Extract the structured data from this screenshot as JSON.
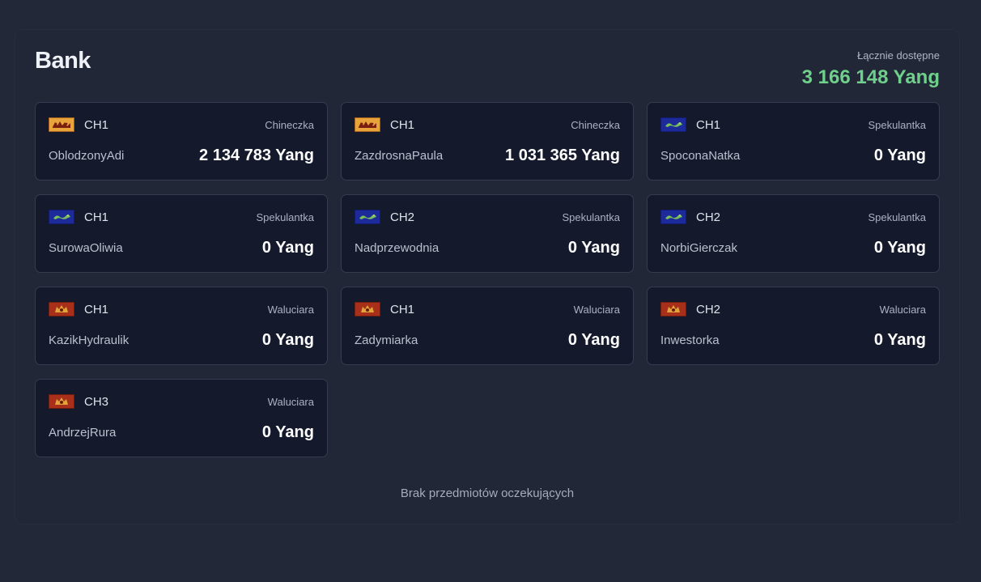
{
  "bank": {
    "title": "Bank",
    "total_label": "Łącznie dostępne",
    "total_value": "3 166 148 Yang",
    "accent_color": "#6fd08b"
  },
  "cards": [
    {
      "flag": "flag-orange-icon",
      "channel": "CH1",
      "role": "Chineczka",
      "name": "OblodzonyAdi",
      "amount": "2 134 783 Yang"
    },
    {
      "flag": "flag-orange-icon",
      "channel": "CH1",
      "role": "Chineczka",
      "name": "ZazdrosnaPaula",
      "amount": "1 031 365 Yang"
    },
    {
      "flag": "flag-blue-icon",
      "channel": "CH1",
      "role": "Spekulantka",
      "name": "SpoconaNatka",
      "amount": "0 Yang"
    },
    {
      "flag": "flag-blue-icon",
      "channel": "CH1",
      "role": "Spekulantka",
      "name": "SurowaOliwia",
      "amount": "0 Yang"
    },
    {
      "flag": "flag-blue-icon",
      "channel": "CH2",
      "role": "Spekulantka",
      "name": "Nadprzewodnia",
      "amount": "0 Yang"
    },
    {
      "flag": "flag-blue-icon",
      "channel": "CH2",
      "role": "Spekulantka",
      "name": "NorbiGierczak",
      "amount": "0 Yang"
    },
    {
      "flag": "flag-red-icon",
      "channel": "CH1",
      "role": "Waluciara",
      "name": "KazikHydraulik",
      "amount": "0 Yang"
    },
    {
      "flag": "flag-red-icon",
      "channel": "CH1",
      "role": "Waluciara",
      "name": "Zadymiarka",
      "amount": "0 Yang"
    },
    {
      "flag": "flag-red-icon",
      "channel": "CH2",
      "role": "Waluciara",
      "name": "Inwestorka",
      "amount": "0 Yang"
    },
    {
      "flag": "flag-red-icon",
      "channel": "CH3",
      "role": "Waluciara",
      "name": "AndrzejRura",
      "amount": "0 Yang"
    }
  ],
  "footer": {
    "text": "Brak przedmiotów oczekujących"
  }
}
